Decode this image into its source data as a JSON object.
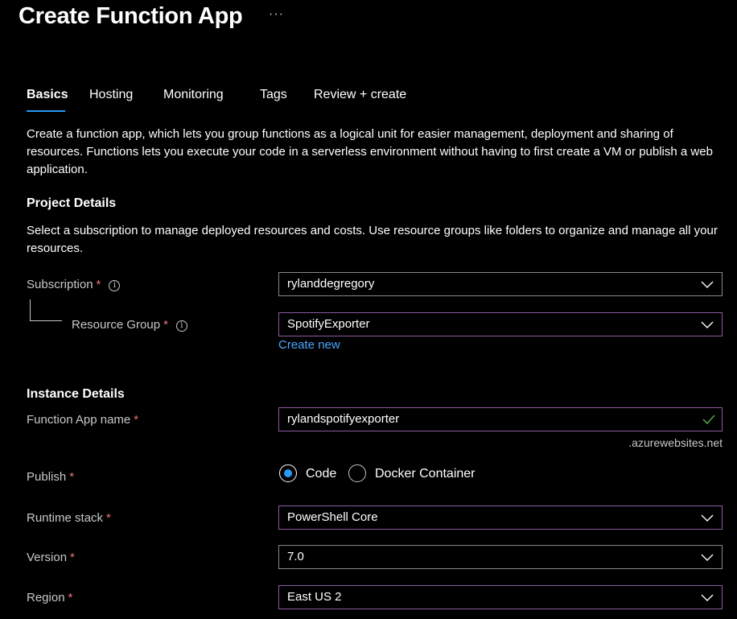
{
  "header": {
    "title": "Create Function App",
    "more_label": "···"
  },
  "tabs": [
    {
      "label": "Basics",
      "active": true
    },
    {
      "label": "Hosting",
      "active": false
    },
    {
      "label": "Monitoring",
      "active": false
    },
    {
      "label": "Tags",
      "active": false
    },
    {
      "label": "Review + create",
      "active": false
    }
  ],
  "intro": "Create a function app, which lets you group functions as a logical unit for easier management, deployment and sharing of resources. Functions lets you execute your code in a serverless environment without having to first create a VM or publish a web application.",
  "project": {
    "heading": "Project Details",
    "description": "Select a subscription to manage deployed resources and costs. Use resource groups like folders to organize and manage all your resources.",
    "subscription": {
      "label": "Subscription",
      "required": "*",
      "value": "rylanddegregory"
    },
    "resource_group": {
      "label": "Resource Group",
      "required": "*",
      "value": "SpotifyExporter",
      "create_new": "Create new"
    }
  },
  "instance": {
    "heading": "Instance Details",
    "app_name": {
      "label": "Function App name",
      "required": "*",
      "value": "rylandspotifyexporter",
      "suffix": ".azurewebsites.net"
    },
    "publish": {
      "label": "Publish",
      "required": "*",
      "options": [
        "Code",
        "Docker Container"
      ],
      "selected": "Code"
    },
    "runtime": {
      "label": "Runtime stack",
      "required": "*",
      "value": "PowerShell Core"
    },
    "version": {
      "label": "Version",
      "required": "*",
      "value": "7.0"
    },
    "region": {
      "label": "Region",
      "required": "*",
      "value": "East US 2"
    }
  },
  "colors": {
    "accent": "#2899f5",
    "required": "#f1707b",
    "link": "#4da6ff",
    "valid": "#57a64a",
    "focus_border": "#8e5aa0"
  },
  "icons": {
    "info": "info-icon",
    "dropdown": "chevron-down-icon",
    "valid": "checkmark-icon"
  }
}
